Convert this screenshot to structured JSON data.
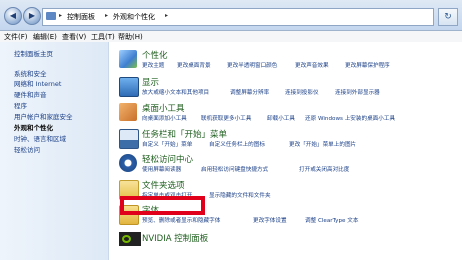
{
  "address": {
    "crumbs": [
      "控制面板",
      "外观和个性化"
    ],
    "back_symbol": "◀",
    "forward_symbol": "▶",
    "refresh_symbol": "↻"
  },
  "menubar": [
    "文件(F)",
    "编辑(E)",
    "查看(V)",
    "工具(T)",
    "帮助(H)"
  ],
  "sidebar": {
    "items": [
      {
        "label": "控制面板主页",
        "active": false
      },
      {
        "label": "系统和安全",
        "active": false
      },
      {
        "label": "网络和 Internet",
        "active": false
      },
      {
        "label": "硬件和声音",
        "active": false
      },
      {
        "label": "程序",
        "active": false
      },
      {
        "label": "用户帐户和家庭安全",
        "active": false
      },
      {
        "label": "外观和个性化",
        "active": true
      },
      {
        "label": "时钟、语言和区域",
        "active": false
      },
      {
        "label": "轻松访问",
        "active": false
      }
    ]
  },
  "categories": [
    {
      "title": "个性化",
      "icon": "personalization-icon",
      "color": "#3f7fd0",
      "links": [
        "更改主题",
        "更改桌面背景",
        "更改半透明窗口颜色",
        "更改声音效果",
        "更改屏幕保护程序"
      ]
    },
    {
      "title": "显示",
      "icon": "display-icon",
      "color": "#2e6bb5",
      "links": [
        "放大或缩小文本和其他项目",
        "调整屏幕分辨率",
        "连接到投影仪",
        "连接到外部显示器"
      ]
    },
    {
      "title": "桌面小工具",
      "icon": "gadgets-icon",
      "color": "#c9702a",
      "links": [
        "向桌面添加小工具",
        "联机获取更多小工具",
        "卸载小工具",
        "还原 Windows 上安装的桌面小工具"
      ]
    },
    {
      "title": "任务栏和「开始」菜单",
      "icon": "taskbar-icon",
      "color": "#3d6ea8",
      "links": [
        "自定义「开始」菜单",
        "自定义任务栏上的图标",
        "更改「开始」菜单上的图片"
      ]
    },
    {
      "title": "轻松访问中心",
      "icon": "ease-of-access-icon",
      "color": "#2b5fa8",
      "links": [
        "使用屏幕阅读器",
        "启用轻松访问键盘快捷方式",
        "打开或关闭高对比度"
      ]
    },
    {
      "title": "文件夹选项",
      "icon": "folder-options-icon",
      "color": "#e6c24a",
      "links": [
        "指定单击或双击打开",
        "显示隐藏的文件和文件夹"
      ]
    },
    {
      "title": "字体",
      "icon": "fonts-icon",
      "color": "#e2b53e",
      "links": [
        "预览、删除或者显示和隐藏字体",
        "更改字体设置",
        "调整 ClearType 文本"
      ]
    },
    {
      "title": "NVIDIA 控制面板",
      "icon": "nvidia-icon",
      "color": "#76b900",
      "links": []
    }
  ]
}
